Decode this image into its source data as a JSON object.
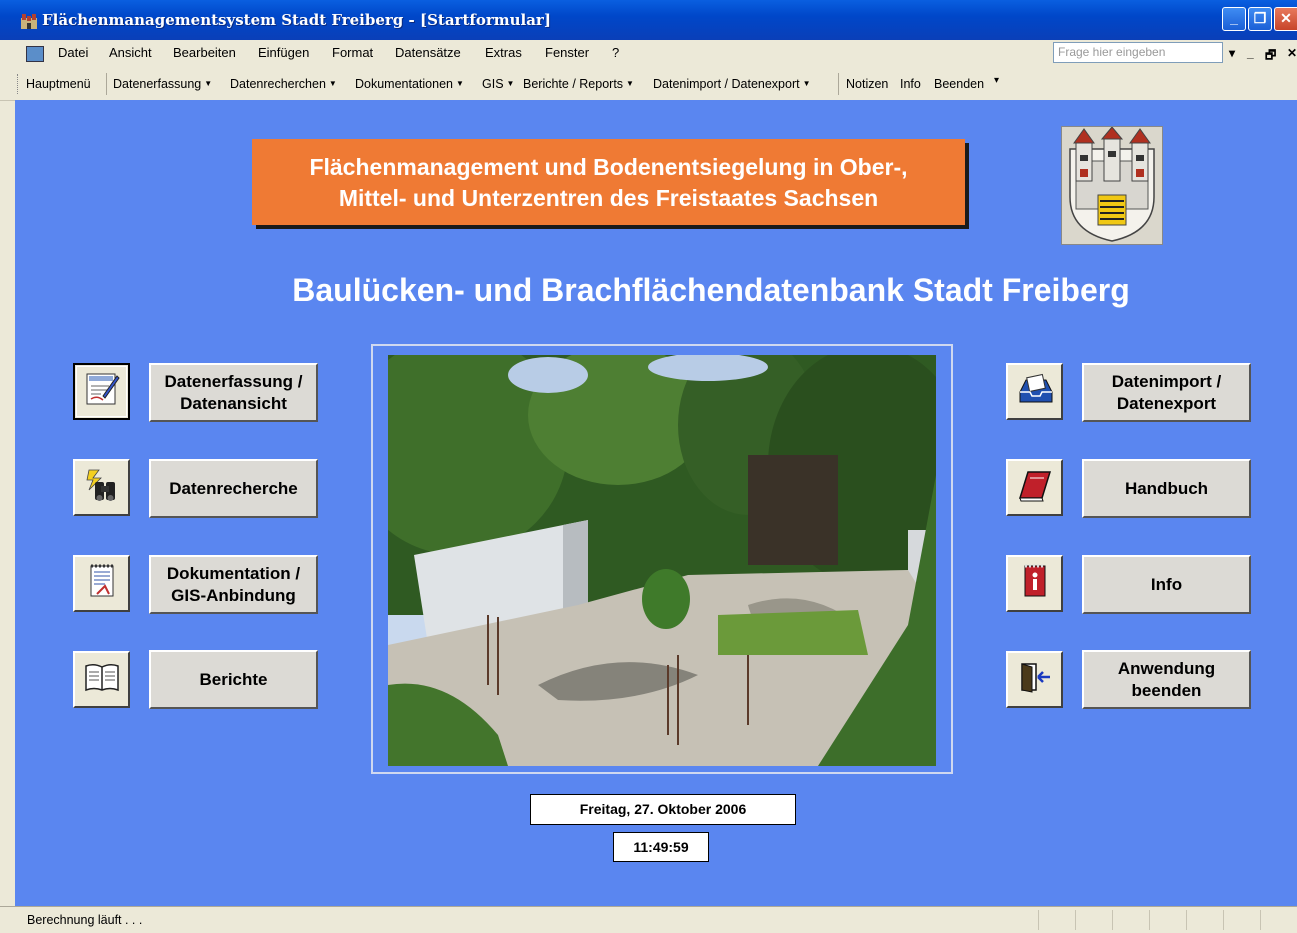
{
  "window": {
    "title": "Flächenmanagementsystem Stadt Freiberg - [Startformular]",
    "controls": [
      "_",
      "❐",
      "✕"
    ]
  },
  "menubar": {
    "items": [
      "Datei",
      "Ansicht",
      "Bearbeiten",
      "Einfügen",
      "Format",
      "Datensätze",
      "Extras",
      "Fenster",
      "?"
    ],
    "help_placeholder": "Frage hier eingeben",
    "mdi_controls": [
      "▾",
      "_",
      "🗗",
      "✕"
    ]
  },
  "toolbar": {
    "items": [
      {
        "label": "Hauptmenü",
        "dropdown": false
      },
      {
        "label": "Datenerfassung",
        "dropdown": true
      },
      {
        "label": "Datenrecherchen",
        "dropdown": true
      },
      {
        "label": "Dokumentationen",
        "dropdown": true
      },
      {
        "label": "GIS",
        "dropdown": true
      },
      {
        "label": "Berichte / Reports",
        "dropdown": true
      },
      {
        "label": "Datenimport / Datenexport",
        "dropdown": true
      },
      {
        "label": "Notizen",
        "dropdown": false
      },
      {
        "label": "Info",
        "dropdown": false
      },
      {
        "label": "Beenden",
        "dropdown": false
      }
    ]
  },
  "form": {
    "banner_line1": "Flächenmanagement und Bodenentsiegelung in Ober-,",
    "banner_line2": "Mittel- und Unterzentren des Freistaates Sachsen",
    "main_title": "Baulücken- und Brachflächendatenbank Stadt Freiberg",
    "left_buttons": [
      {
        "label": "Datenerfassung /\nDatenansicht",
        "icon": "form-pen-icon"
      },
      {
        "label": "Datenrecherche",
        "icon": "binoculars-icon"
      },
      {
        "label": "Dokumentation /\nGIS-Anbindung",
        "icon": "document-icon"
      },
      {
        "label": "Berichte",
        "icon": "book-icon"
      }
    ],
    "right_buttons": [
      {
        "label": "Datenimport /\nDatenexport",
        "icon": "inbox-tray-icon"
      },
      {
        "label": "Handbuch",
        "icon": "manual-icon"
      },
      {
        "label": "Info",
        "icon": "info-icon"
      },
      {
        "label": "Anwendung\nbeenden",
        "icon": "exit-door-icon"
      }
    ],
    "date": "Freitag, 27. Oktober 2006",
    "time": "11:49:59"
  },
  "statusbar": {
    "text": "Berechnung läuft . . ."
  },
  "colors": {
    "form_background": "#5a86f0",
    "banner": "#ef7a34",
    "titlebar": "#0a5fe0"
  }
}
